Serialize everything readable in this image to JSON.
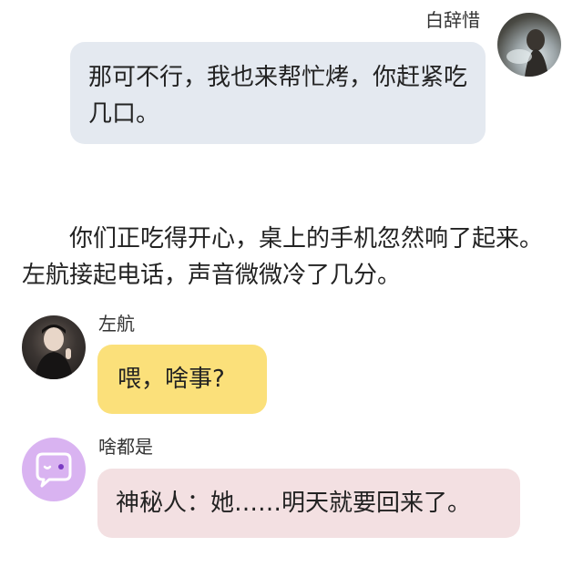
{
  "messages": [
    {
      "sender": "白辞惜",
      "side": "right",
      "text": "那可不行，我也来帮忙烤，你赶紧吃几口。",
      "bubble_color": "#e4e9f0"
    },
    {
      "sender": "左航",
      "side": "left",
      "text": "喂，啥事?",
      "bubble_color": "#fbe07a"
    },
    {
      "sender": "啥都是",
      "side": "left",
      "text": "神秘人：她……明天就要回来了。",
      "bubble_color": "#f3e0e2",
      "avatar_icon": "chat-bubble-face-icon",
      "avatar_color": "#d9b3f1"
    }
  ],
  "narration": "你们正吃得开心，桌上的手机忽然响了起来。左航接起电话，声音微微冷了几分。"
}
